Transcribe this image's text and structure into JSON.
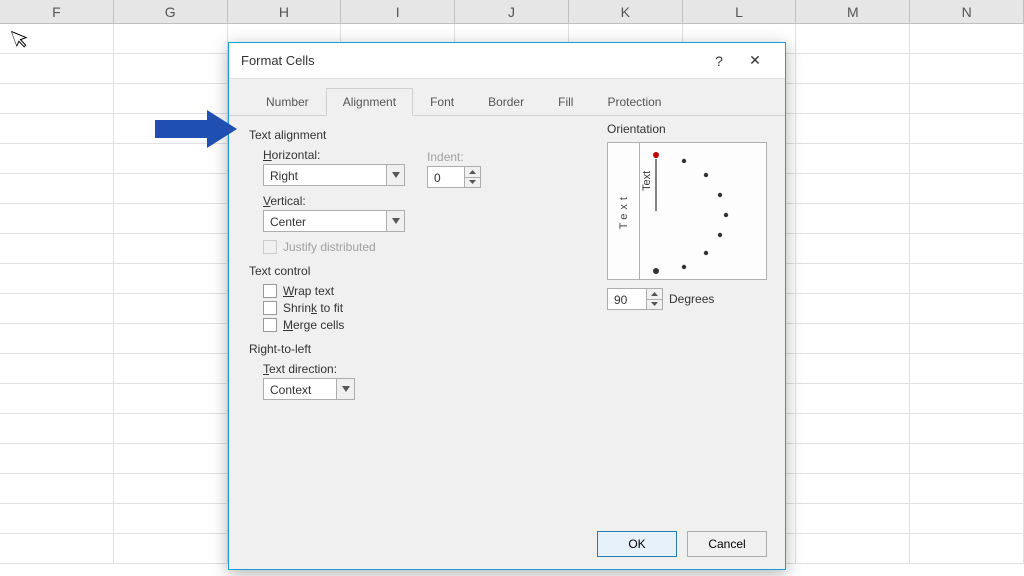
{
  "columns": [
    "F",
    "G",
    "H",
    "I",
    "J",
    "K",
    "L",
    "M",
    "N"
  ],
  "row_count": 18,
  "dialog": {
    "title": "Format Cells",
    "help": "?",
    "close": "✕",
    "tabs": [
      "Number",
      "Alignment",
      "Font",
      "Border",
      "Fill",
      "Protection"
    ],
    "active_tab": "Alignment",
    "text_alignment": {
      "label": "Text alignment",
      "horizontal_label": "Horizontal:",
      "horizontal_value": "Right",
      "vertical_label": "Vertical:",
      "vertical_value": "Center",
      "indent_label": "Indent:",
      "indent_value": "0",
      "justify_label": "Justify distributed"
    },
    "text_control": {
      "label": "Text control",
      "wrap": "Wrap text",
      "shrink": "Shrink to fit",
      "merge": "Merge cells"
    },
    "rtl": {
      "label": "Right-to-left",
      "direction_label": "Text direction:",
      "direction_value": "Context"
    },
    "orientation": {
      "label": "Orientation",
      "vert_word": "Text",
      "dial_word": "Text",
      "degrees_value": "90",
      "degrees_label": "Degrees"
    },
    "ok": "OK",
    "cancel": "Cancel"
  }
}
